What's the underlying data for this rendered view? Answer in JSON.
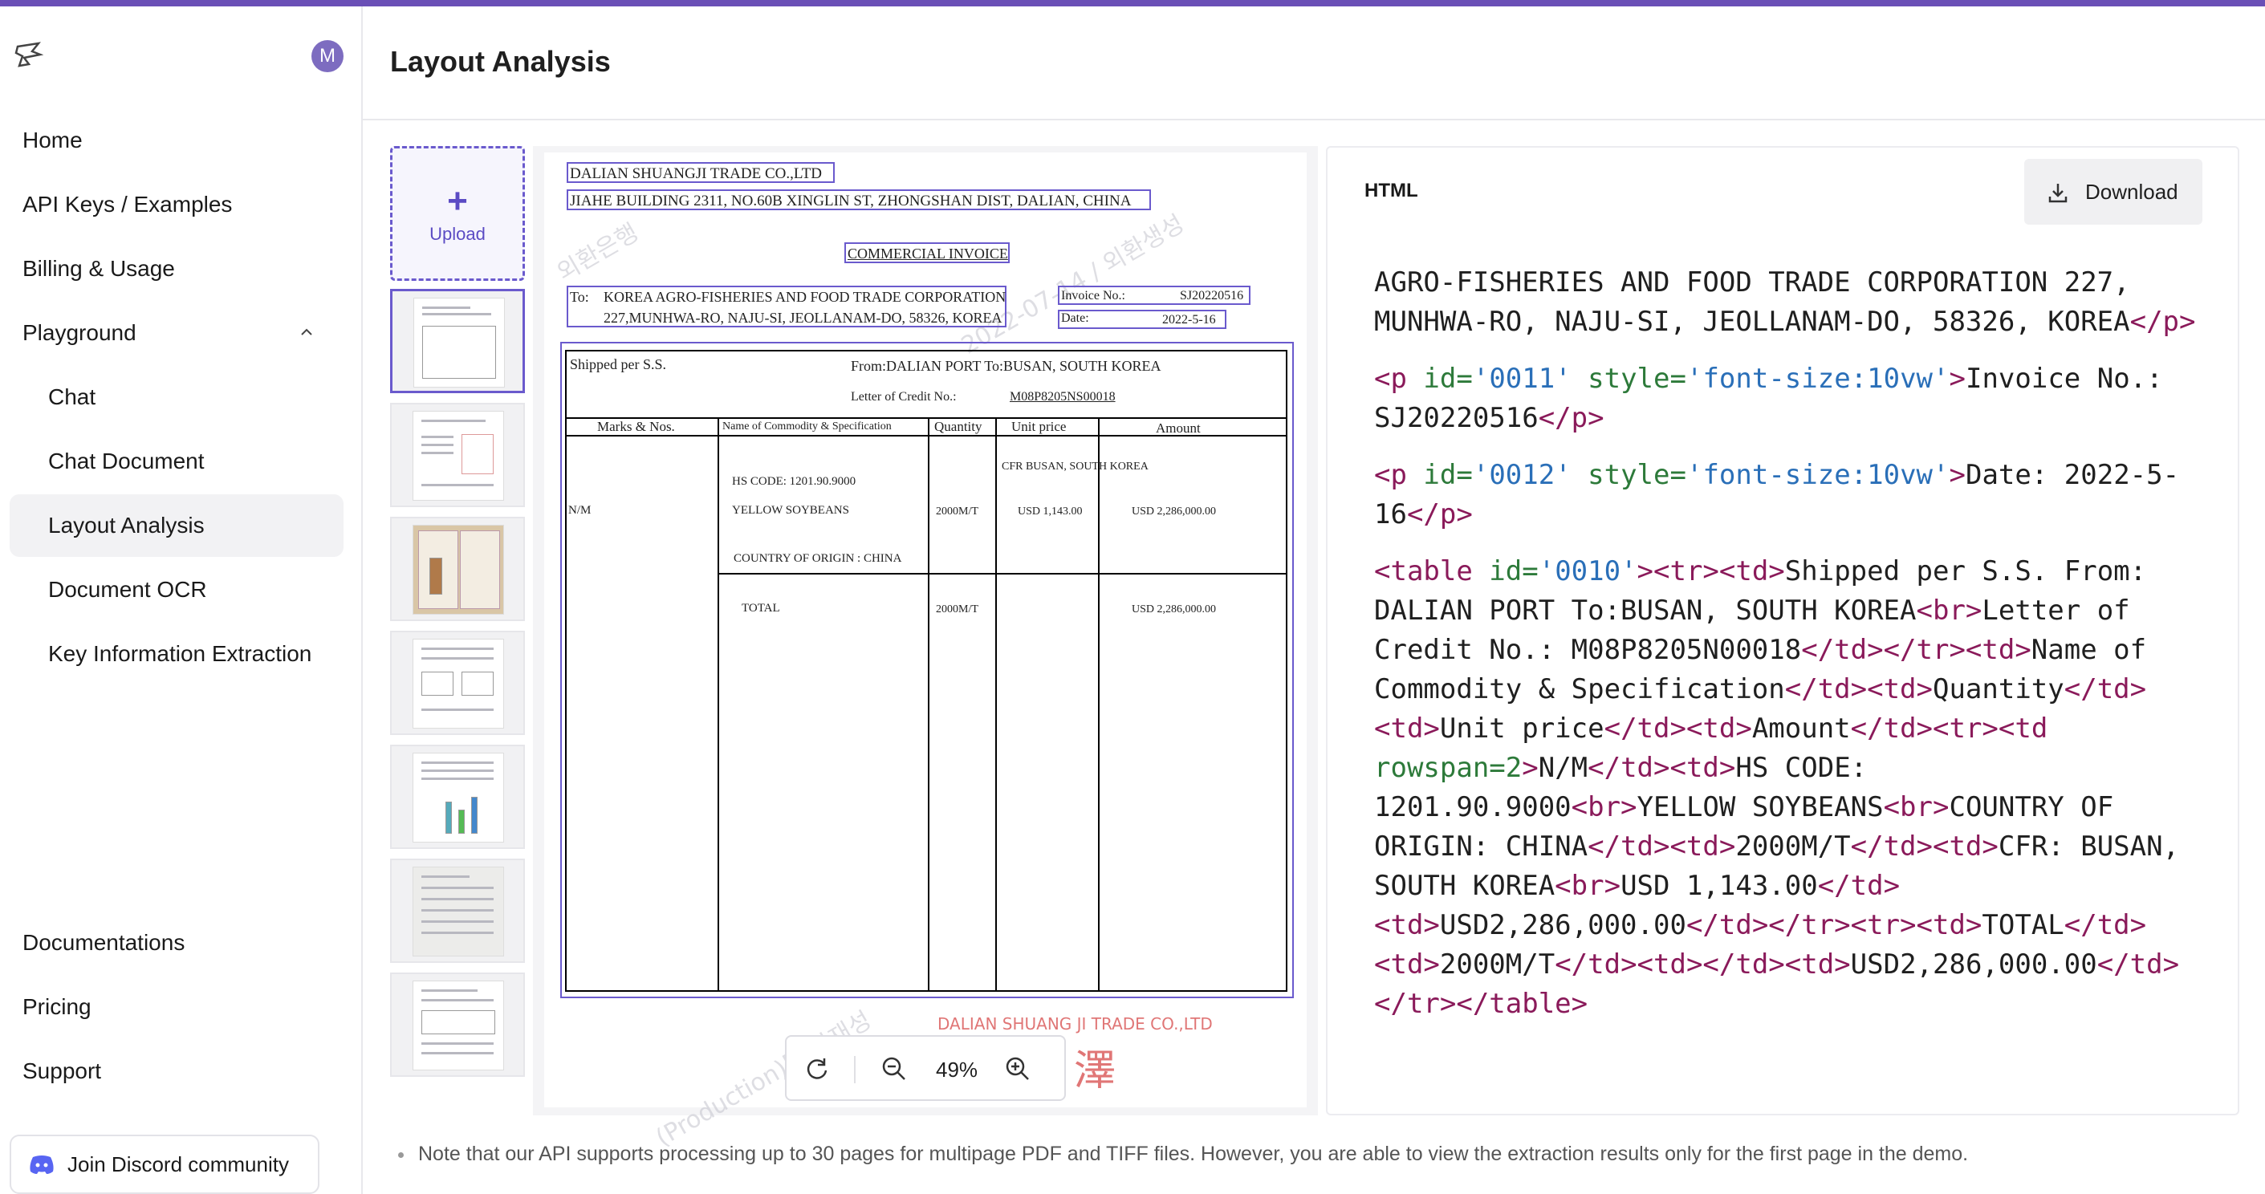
{
  "sidebar": {
    "avatar_letter": "M",
    "items": [
      {
        "label": "Home"
      },
      {
        "label": "API Keys / Examples"
      },
      {
        "label": "Billing & Usage"
      },
      {
        "label": "Playground"
      },
      {
        "label": "Chat"
      },
      {
        "label": "Chat Document"
      },
      {
        "label": "Layout Analysis"
      },
      {
        "label": "Document OCR"
      },
      {
        "label": "Key Information Extraction"
      }
    ],
    "footer": [
      {
        "label": "Documentations"
      },
      {
        "label": "Pricing"
      },
      {
        "label": "Support"
      }
    ],
    "discord_label": "Join Discord community"
  },
  "header": {
    "title": "Layout Analysis"
  },
  "upload": {
    "label": "Upload",
    "plus": "+"
  },
  "document": {
    "company": "DALIAN SHUANGJI TRADE CO.,LTD",
    "address": "JIAHE BUILDING 2311, NO.60B XINGLIN ST, ZHONGSHAN DIST, DALIAN, CHINA",
    "doc_title": "COMMERCIAL INVOICE",
    "to_label": "To:",
    "to_line1": "KOREA AGRO-FISHERIES AND FOOD TRADE CORPORATION",
    "to_line2": "227,MUNHWA-RO, NAJU-SI, JEOLLANAM-DO, 58326, KOREA",
    "invoice_label": "Invoice No.:",
    "invoice_no": "SJ20220516",
    "date_label": "Date:",
    "date": "2022-5-16",
    "shipped": "Shipped per S.S.",
    "from_to": "From:DALIAN PORT    To:BUSAN, SOUTH KOREA",
    "lc_label": "Letter of Credit No.:",
    "lc_no": "M08P8205NS00018",
    "headers": [
      "Marks & Nos.",
      "Name of Commodity & Specification",
      "Quantity",
      "Unit price",
      "Amount"
    ],
    "cfr": "CFR  BUSAN, SOUTH KOREA",
    "hs": "HS CODE: 1201.90.9000",
    "marks": "N/M",
    "item": "YELLOW SOYBEANS",
    "qty": "2000M/T",
    "unit_price": "USD 1,143.00",
    "amount": "USD 2,286,000.00",
    "origin": "COUNTRY OF ORIGIN : CHINA",
    "total_label": "TOTAL",
    "total_qty": "2000M/T",
    "total_amount": "USD 2,286,000.00",
    "stamp_text": "DALIAN SHUANG JI TRADE CO.,LTD",
    "stamp_char": "澤"
  },
  "zoom": {
    "value": "49%"
  },
  "panel": {
    "title": "HTML",
    "download_label": "Download",
    "code": {
      "b1_text": "AGRO-FISHERIES AND FOOD TRADE CORPORATION 227, MUNHWA-RO, NAJU-SI, JEOLLANAM-DO, 58326, KOREA",
      "b1_close": "</p>",
      "b2_open": "<p ",
      "b2_attr1": "id=",
      "b2_val1": "'0011'",
      "b2_attr2": " style=",
      "b2_val2": "'font-size:10vw'",
      "b2_gt": ">",
      "b2_text": "Invoice No.: SJ20220516",
      "b2_close": "</p>",
      "b3_open": "<p ",
      "b3_attr1": "id=",
      "b3_val1": "'0012'",
      "b3_attr2": " style=",
      "b3_val2": "'font-size:10vw'",
      "b3_gt": ">",
      "b3_text": "Date: 2022-5-16",
      "b3_close": "</p>",
      "b4_open": "<table ",
      "b4_attr": "id=",
      "b4_val": "'0010'",
      "b4_gt": "><tr><td>",
      "b4_t1": "Shipped per S.S. From: DALIAN PORT To:BUSAN, SOUTH KOREA",
      "b4_br1": "<br>",
      "b4_t2": "Letter of Credit No.: M08P8205N00018",
      "b4_tg2": "</td></tr><td>",
      "b4_t3": "Name of Commodity & Specification",
      "b4_tg3": "</td><td>",
      "b4_t4": "Quantity",
      "b4_tg4": "</td><td>",
      "b4_t5": "Unit price",
      "b4_tg5": "</td><td>",
      "b4_t6": "Amount",
      "b4_tg6": "</td><tr><td ",
      "b4_rowspan": "rowspan=2",
      "b4_tg7": ">",
      "b4_t7": "N/M",
      "b4_tg8": "</td><td>",
      "b4_t8": "HS CODE: 1201.90.9000",
      "b4_br2": "<br>",
      "b4_t9": "YELLOW SOYBEANS",
      "b4_br3": "<br>",
      "b4_t10": "COUNTRY OF ORIGIN: CHINA",
      "b4_tg9": "</td><td>",
      "b4_t11": "2000M/T",
      "b4_tg10": "</td><td>",
      "b4_t12": "CFR: BUSAN, SOUTH KOREA",
      "b4_br4": "<br>",
      "b4_t13": "USD 1,143.00",
      "b4_tg11": "</td><td>",
      "b4_t14": "USD2,286,000.00",
      "b4_tg12": "</td></tr><tr><td>",
      "b4_t15": "TOTAL",
      "b4_tg13": "</td><td>",
      "b4_t16": "2000M/T",
      "b4_tg14": "</td><td></td><td>",
      "b4_t17": "USD2,286,000.00",
      "b4_tg15": "</td></tr></table>"
    }
  },
  "note": "Note that our API supports processing up to 30 pages for multipage PDF and TIFF files. However, you are able to view the extraction results only for the first page in the demo.",
  "colors": {
    "accent": "#6a5acd",
    "topbar": "#6a4fb6",
    "tag": "#8a1a5a",
    "attr": "#2d7a3a",
    "value": "#2a6fb8"
  }
}
